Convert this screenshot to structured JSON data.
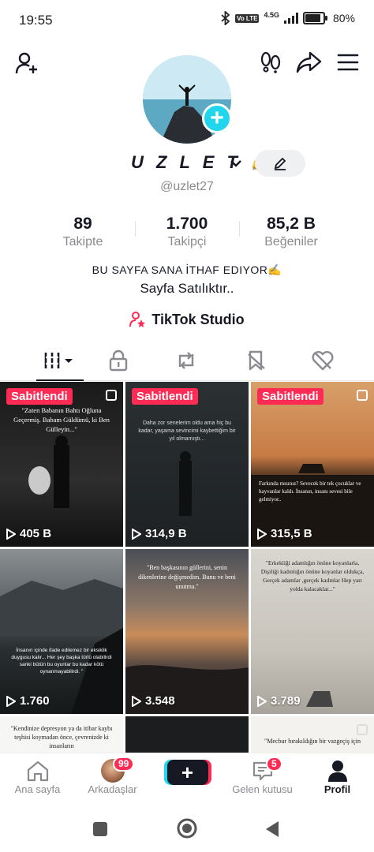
{
  "status": {
    "time": "19:55",
    "net_label": "4.5G",
    "volte": "Vo LTE",
    "battery": "80%",
    "battery_level": 0.8
  },
  "header": {
    "add_friend_icon": "add-person-icon",
    "footprint_icon": "footprint-icon",
    "share_icon": "share-icon",
    "menu_icon": "hamburger-menu-icon"
  },
  "profile": {
    "display_name": "U Z L E T ✍️",
    "username": "@uzlet27",
    "stats": [
      {
        "value": "89",
        "label": "Takipte"
      },
      {
        "value": "1.700",
        "label": "Takipçi"
      },
      {
        "value": "85,2 B",
        "label": "Beğeniler"
      }
    ],
    "bio_line1": "BU SAYFA SANA İTHAF EDIYOR✍️",
    "bio_line2": "Sayfa Satılıktır..",
    "studio_label": "TikTok Studio"
  },
  "tabs": [
    "videos",
    "private",
    "reposts",
    "favorites",
    "liked"
  ],
  "videos": [
    {
      "pinned": "Sabitlendi",
      "views": "405 B",
      "caption": "\"Zaten Babanın Bahtı Oğluna Geçermiş. Babam Güldümü, ki Ben Gülleyin...\""
    },
    {
      "pinned": "Sabitlendi",
      "views": "314,9 B",
      "caption": "Daha zor senelerim oldu ama hiç bu kadar, yaşama sevincimi kaybettiğim bir yıl olmamıştı..."
    },
    {
      "pinned": "Sabitlendi",
      "views": "315,5 B",
      "caption": "Farkında mısınız? Sevecek bir tek çocuklar ve hayvanlar kaldı. İnsanın, insanı sevesi bile gelmiyor.."
    },
    {
      "pinned": "",
      "views": "1.760",
      "caption": "İnsanın içinde ifade edilemez bir eksiklik duygusu kalır... Her şey başka türlü olabilirdi sanki bütün bu oyunlar bu kadar kötü oynanmayabilirdi. \""
    },
    {
      "pinned": "",
      "views": "3.548",
      "caption": "\"Ben başkasının güllerini, senin dikenlerine değişmedim. Bunu ve beni unutma.\""
    },
    {
      "pinned": "",
      "views": "3.789",
      "caption": "\"Erkekliği adamlığın önüne koyanlarla, Dişiliği kadınlığın önüne koyanlar oldukça, Gerçek adamlar ,gerçek kadınlar Hep yarı yolda kalacaklar...\""
    },
    {
      "pinned": "",
      "views": "",
      "caption": "\"Kendinize depresyon ya da itibar kaybı teşhisi koymadan önce, çevrenizde ki insanların"
    },
    {
      "pinned": "",
      "views": "",
      "caption": ""
    },
    {
      "pinned": "",
      "views": "",
      "caption": "\"Mecbur bırakıldığın bir vazgeçiş için"
    }
  ],
  "bottom_nav": {
    "home": "Ana sayfa",
    "friends": "Arkadaşlar",
    "friends_badge": "99",
    "inbox": "Gelen kutusu",
    "inbox_badge": "5",
    "profile": "Profil"
  },
  "colors": {
    "accent_red": "#fe2c55",
    "accent_cyan": "#20d5ec",
    "text": "#161823",
    "muted": "#8a8b91"
  }
}
